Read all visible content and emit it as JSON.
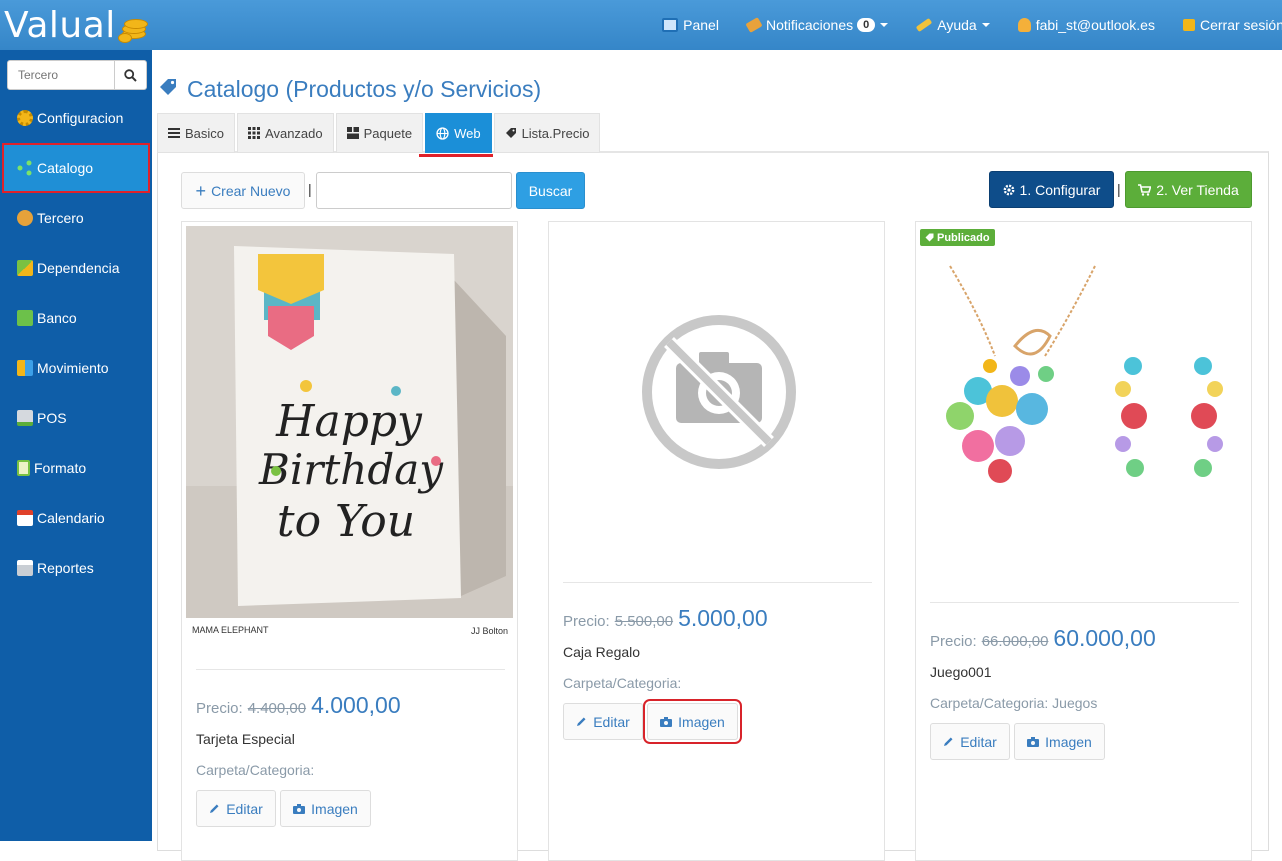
{
  "app": {
    "brand": "Valual"
  },
  "topnav": {
    "panel": "Panel",
    "notifications": "Notificaciones",
    "notifications_count": "0",
    "help": "Ayuda",
    "user": "fabi_st@outlook.es",
    "logout": "Cerrar sesión"
  },
  "sidebar": {
    "search_placeholder": "Tercero",
    "items": [
      {
        "label": "Configuracion",
        "icon": "gear-icon"
      },
      {
        "label": "Catalogo",
        "icon": "share-nodes-icon"
      },
      {
        "label": "Tercero",
        "icon": "users-icon"
      },
      {
        "label": "Dependencia",
        "icon": "boxes-icon"
      },
      {
        "label": "Banco",
        "icon": "bank-icon"
      },
      {
        "label": "Movimiento",
        "icon": "blocks-icon"
      },
      {
        "label": "POS",
        "icon": "cash-register-icon"
      },
      {
        "label": "Formato",
        "icon": "document-icon"
      },
      {
        "label": "Calendario",
        "icon": "calendar-icon"
      },
      {
        "label": "Reportes",
        "icon": "printer-icon"
      }
    ]
  },
  "page": {
    "title": "Catalogo (Productos y/o Servicios)"
  },
  "tabs": [
    {
      "label": "Basico",
      "icon": "list-icon"
    },
    {
      "label": "Avanzado",
      "icon": "grid-icon"
    },
    {
      "label": "Paquete",
      "icon": "layout-icon"
    },
    {
      "label": "Web",
      "icon": "globe-icon"
    },
    {
      "label": "Lista.Precio",
      "icon": "tag-icon"
    }
  ],
  "toolbar": {
    "new_label": "Crear Nuevo",
    "search_label": "Buscar",
    "configure_label": "1. Configurar",
    "store_label": "2. Ver Tienda",
    "separator": "|"
  },
  "products": [
    {
      "price_label": "Precio:",
      "old_price": "4.400,00",
      "new_price": "4.000,00",
      "name": "Tarjeta Especial",
      "category": "Carpeta/Categoria:",
      "edit_label": "Editar",
      "image_label": "Imagen",
      "caption_left": "MAMA ELEPHANT",
      "caption_right": "JJ Bolton",
      "card_text": [
        "Happy",
        "Birthday",
        "to You"
      ]
    },
    {
      "price_label": "Precio:",
      "old_price": "5.500,00",
      "new_price": "5.000,00",
      "name": "Caja Regalo",
      "category": "Carpeta/Categoria:",
      "edit_label": "Editar",
      "image_label": "Imagen"
    },
    {
      "badge": "Publicado",
      "price_label": "Precio:",
      "old_price": "66.000,00",
      "new_price": "60.000,00",
      "name": "Juego001",
      "category": "Carpeta/Categoria: Juegos",
      "edit_label": "Editar",
      "image_label": "Imagen"
    }
  ],
  "colors": {
    "topbar": "#3586c8",
    "sidebar": "#0f5ea8",
    "active_tab": "#1b8fd8",
    "highlight": "#e0212a",
    "configure_btn": "#0e4d8a",
    "store_btn": "#5cae3a",
    "price": "#3a7dbf"
  }
}
